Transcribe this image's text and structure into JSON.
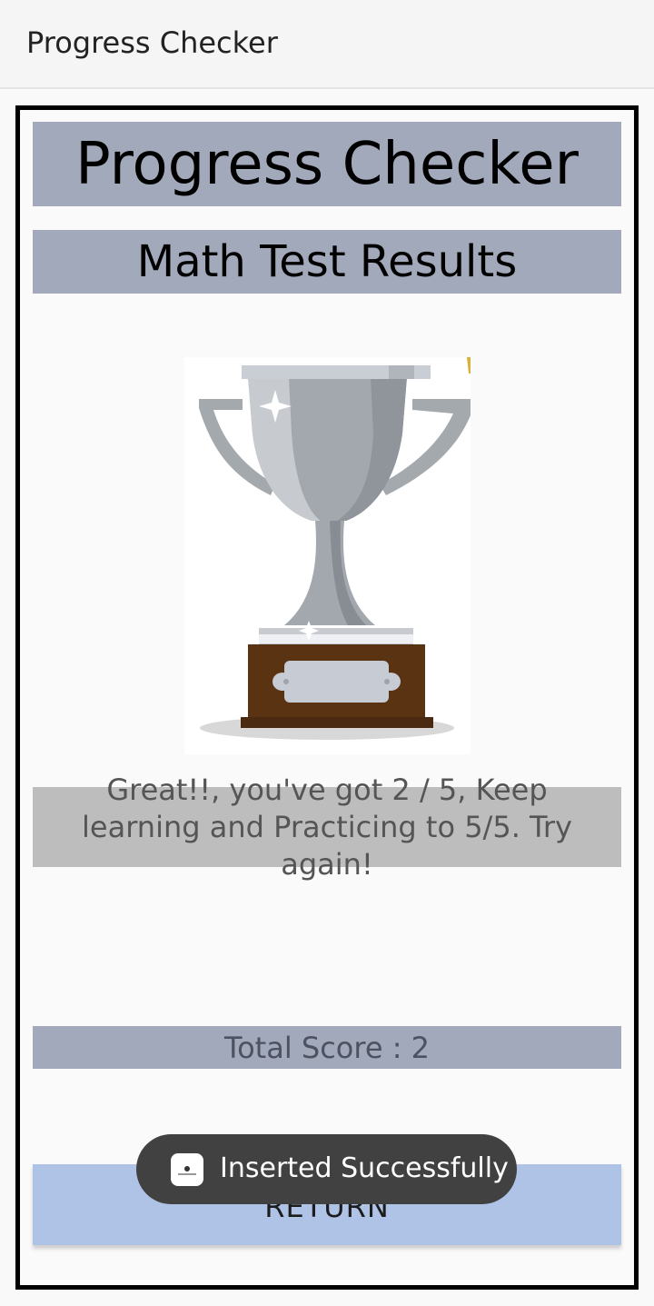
{
  "appbar": {
    "title": "Progress Checker"
  },
  "header": {
    "title": "Progress Checker",
    "subtitle": "Math Test Results"
  },
  "trophy": {
    "icon": "trophy-icon",
    "colors": {
      "cup": "#a3a8ae",
      "base": "#5a3312"
    }
  },
  "result": {
    "message": "Great!!, you've got 2 / 5, Keep learning and Practicing to 5/5. Try again!",
    "total_score": "Total Score : 2"
  },
  "actions": {
    "return_label": "RETURN"
  },
  "toast": {
    "message": "Inserted Successfully",
    "icon": "app-icon"
  },
  "colors": {
    "header_background": "#a2a9bb",
    "message_background": "#bdbdbd",
    "button_background": "#afc3e6",
    "toast_background": "#414141"
  }
}
